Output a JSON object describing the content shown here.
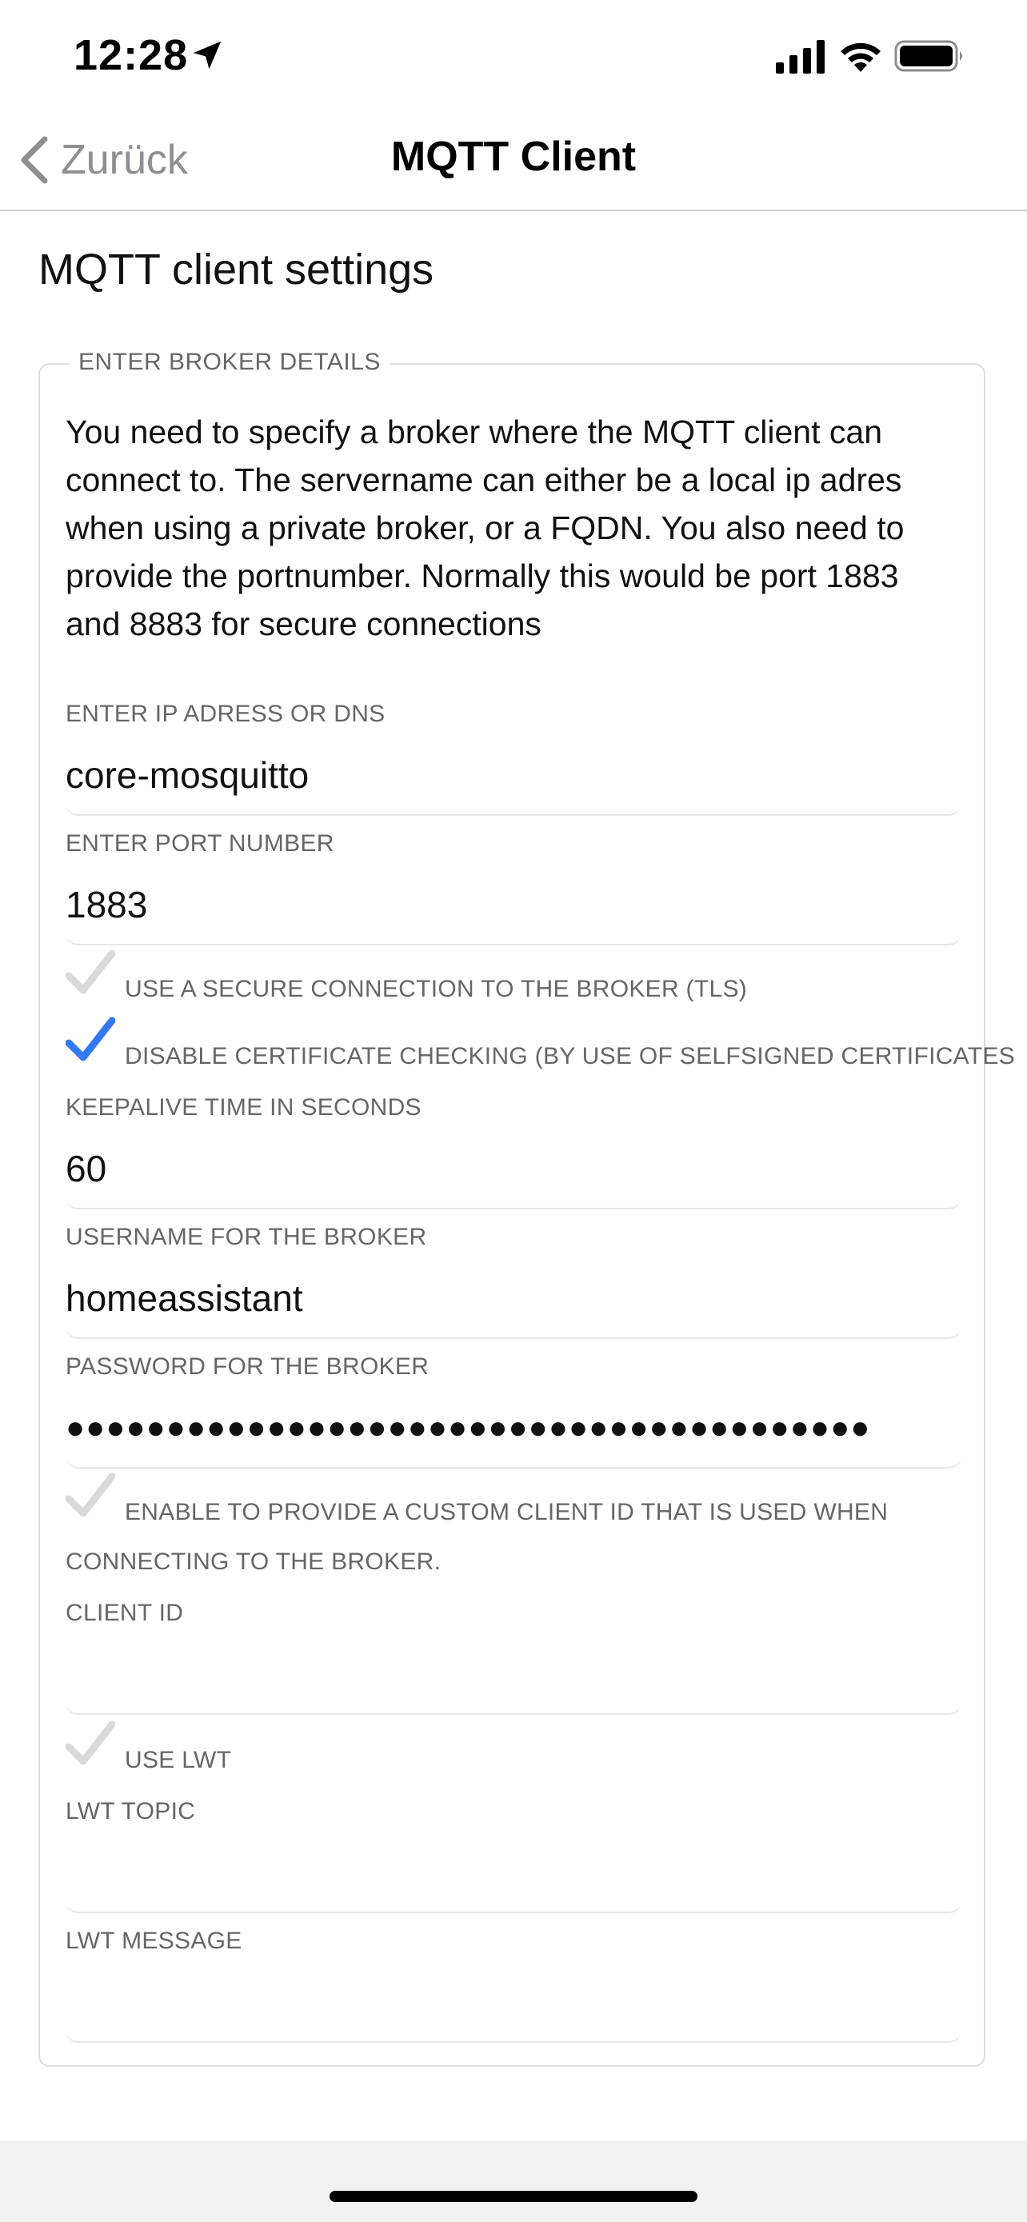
{
  "status_bar": {
    "time": "12:28",
    "icons": [
      "location-arrow-icon",
      "cellular-signal-icon",
      "wifi-icon",
      "battery-icon"
    ]
  },
  "nav": {
    "back_label": "Zurück",
    "title": "MQTT Client"
  },
  "page": {
    "title": "MQTT client settings"
  },
  "section": {
    "legend": "ENTER BROKER DETAILS",
    "description": "You need to specify a broker where the MQTT client can connect to. The servername can either be a local ip adres when using a private broker, or a FQDN. You also need to provide the portnumber. Normally this would be port 1883 and 8883 for secure connections"
  },
  "fields": {
    "host": {
      "label": "ENTER IP ADRESS OR DNS",
      "value": "core-mosquitto"
    },
    "port": {
      "label": "ENTER PORT NUMBER",
      "value": "1883"
    },
    "keepalive": {
      "label": "KEEPALIVE TIME IN SECONDS",
      "value": "60"
    },
    "username": {
      "label": "USERNAME FOR THE BROKER",
      "value": "homeassistant"
    },
    "password": {
      "label": "PASSWORD FOR THE BROKER",
      "value": "●●●●●●●●●●●●●●●●●●●●●●●●●●●●●●●●●●●●●●●●"
    },
    "client_id": {
      "label": "CLIENT ID",
      "value": ""
    },
    "lwt_topic": {
      "label": "LWT TOPIC",
      "value": ""
    },
    "lwt_message": {
      "label": "LWT MESSAGE",
      "value": ""
    }
  },
  "checkboxes": {
    "tls": {
      "label": "USE A SECURE CONNECTION TO THE BROKER (TLS)",
      "checked": false
    },
    "disable_cert": {
      "label": "DISABLE CERTIFICATE CHECKING (BY USE OF SELFSIGNED CERTIFICATES",
      "checked": true
    },
    "custom_client_id": {
      "label_line1": "ENABLE TO PROVIDE A CUSTOM CLIENT ID THAT IS USED WHEN",
      "label_line2": "CONNECTING TO THE BROKER.",
      "checked": false
    },
    "lwt": {
      "label": "USE LWT",
      "checked": false
    }
  },
  "colors": {
    "accent": "#3478f6",
    "check_off": "#d9d9d9",
    "label": "#666666",
    "back": "#8e8e93"
  }
}
